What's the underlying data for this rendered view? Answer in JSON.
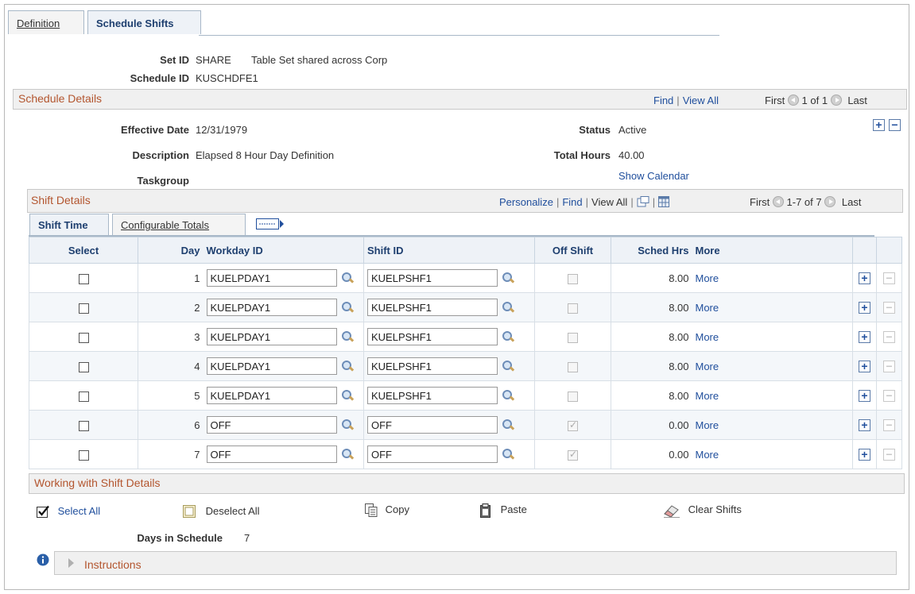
{
  "tabs": [
    {
      "label": "Definition"
    },
    {
      "label": "Schedule Shifts"
    }
  ],
  "header": {
    "set_id_label": "Set ID",
    "set_id_value": "SHARE",
    "set_id_desc": "Table Set shared across Corp",
    "schedule_id_label": "Schedule ID",
    "schedule_id_value": "KUSCHDFE1"
  },
  "schedule_details": {
    "title": "Schedule Details",
    "find": "Find",
    "view_all": "View All",
    "first": "First",
    "range": "1 of 1",
    "last": "Last",
    "effective_date_label": "Effective Date",
    "effective_date": "12/31/1979",
    "description_label": "Description",
    "description": "Elapsed 8 Hour Day Definition",
    "taskgroup_label": "Taskgroup",
    "status_label": "Status",
    "status": "Active",
    "total_hours_label": "Total Hours",
    "total_hours": "40.00",
    "show_calendar": "Show Calendar"
  },
  "shift_details": {
    "title": "Shift Details",
    "personalize": "Personalize",
    "find": "Find",
    "view_all": "View All",
    "first": "First",
    "range": "1-7 of 7",
    "last": "Last",
    "tabs": [
      {
        "label": "Shift Time"
      },
      {
        "label": "Configurable Totals"
      }
    ],
    "columns": {
      "select": "Select",
      "day": "Day",
      "workday_id": "Workday ID",
      "shift_id": "Shift ID",
      "off_shift": "Off Shift",
      "sched_hrs": "Sched Hrs",
      "more": "More"
    },
    "rows": [
      {
        "day": "1",
        "workday_id": "KUELPDAY1",
        "shift_id": "KUELPSHF1",
        "off_shift": false,
        "sched_hrs": "8.00",
        "more": "More"
      },
      {
        "day": "2",
        "workday_id": "KUELPDAY1",
        "shift_id": "KUELPSHF1",
        "off_shift": false,
        "sched_hrs": "8.00",
        "more": "More"
      },
      {
        "day": "3",
        "workday_id": "KUELPDAY1",
        "shift_id": "KUELPSHF1",
        "off_shift": false,
        "sched_hrs": "8.00",
        "more": "More"
      },
      {
        "day": "4",
        "workday_id": "KUELPDAY1",
        "shift_id": "KUELPSHF1",
        "off_shift": false,
        "sched_hrs": "8.00",
        "more": "More"
      },
      {
        "day": "5",
        "workday_id": "KUELPDAY1",
        "shift_id": "KUELPSHF1",
        "off_shift": false,
        "sched_hrs": "8.00",
        "more": "More"
      },
      {
        "day": "6",
        "workday_id": "OFF",
        "shift_id": "OFF",
        "off_shift": true,
        "sched_hrs": "0.00",
        "more": "More"
      },
      {
        "day": "7",
        "workday_id": "OFF",
        "shift_id": "OFF",
        "off_shift": true,
        "sched_hrs": "0.00",
        "more": "More"
      }
    ]
  },
  "working": {
    "title": "Working with Shift Details",
    "select_all": "Select All",
    "deselect_all": "Deselect All",
    "copy": "Copy",
    "paste": "Paste",
    "clear_shifts": "Clear Shifts",
    "days_label": "Days in Schedule",
    "days_value": "7"
  },
  "instructions": {
    "label": "Instructions"
  },
  "colors": {
    "accent_title": "#b3552e",
    "link": "#1f4e9c"
  }
}
